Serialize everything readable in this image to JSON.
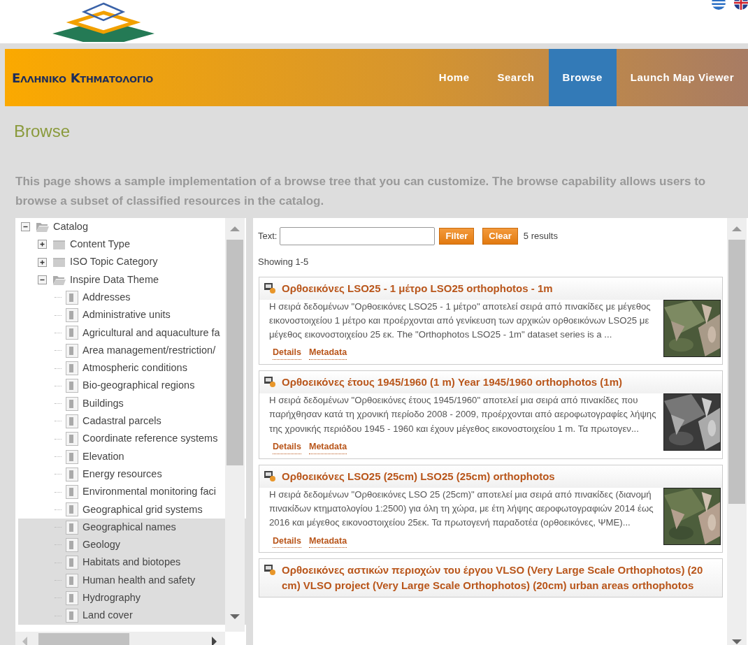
{
  "header": {
    "logo_text": "Ελληνικο Κτηματολογιο",
    "languages": [
      {
        "kind": "greek",
        "selected": false
      },
      {
        "kind": "english",
        "selected": false
      }
    ],
    "nav": [
      {
        "label": "Home",
        "selected": false
      },
      {
        "label": "Search",
        "selected": false
      },
      {
        "label": "Browse",
        "selected": true
      },
      {
        "label": "Launch Map Viewer",
        "selected": false
      }
    ]
  },
  "page": {
    "title": "Browse",
    "intro": "This page shows a sample implementation of a browse tree that you can customize. The browse capability allows users to browse a subset of classified resources in the catalog."
  },
  "tree": [
    {
      "label": "Catalog",
      "expanded": true,
      "children": [
        {
          "label": "Content Type",
          "expanded": false
        },
        {
          "label": "ISO Topic Category",
          "expanded": false
        },
        {
          "label": "Inspire Data Theme",
          "expanded": true,
          "children": [
            {
              "label": "Addresses",
              "shaded": false
            },
            {
              "label": "Administrative units",
              "shaded": false
            },
            {
              "label": "Agricultural and aquaculture fa",
              "shaded": false
            },
            {
              "label": "Area management/restriction/",
              "shaded": false
            },
            {
              "label": "Atmospheric conditions",
              "shaded": false
            },
            {
              "label": "Bio-geographical regions",
              "shaded": false
            },
            {
              "label": "Buildings",
              "shaded": false
            },
            {
              "label": "Cadastral parcels",
              "shaded": false
            },
            {
              "label": "Coordinate reference systems",
              "shaded": false
            },
            {
              "label": "Elevation",
              "shaded": false
            },
            {
              "label": "Energy resources",
              "shaded": false
            },
            {
              "label": "Environmental monitoring faci",
              "shaded": false
            },
            {
              "label": "Geographical grid systems",
              "shaded": false
            },
            {
              "label": "Geographical names",
              "shaded": true
            },
            {
              "label": "Geology",
              "shaded": true
            },
            {
              "label": "Habitats and biotopes",
              "shaded": true
            },
            {
              "label": "Human health and safety",
              "shaded": true
            },
            {
              "label": "Hydrography",
              "shaded": true
            },
            {
              "label": "Land cover",
              "shaded": true
            }
          ]
        }
      ]
    }
  ],
  "filter": {
    "label": "Text:",
    "buttons": [
      "Filter",
      "Clear"
    ],
    "count": "5 results",
    "showing": "Showing 1-5"
  },
  "results": [
    {
      "title": "Ορθοεικόνες LSO25 - 1 μέτρο LSO25 orthophotos - 1m",
      "description": "Η σειρά δεδομένων \"Ορθοεικόνες LSO25 - 1 μέτρο\" αποτελεί σειρά από πινακίδες με μέγεθος εικονοστοιχείου 1 μέτρο και προέρχονται από γενίκευση των αρχικών ορθοεικόνων LSO25 με μέγεθος εικονοστοιχείου 25 εκ. The \"Orthophotos LSO25 - 1m\" dataset series is a ...",
      "links": [
        "Details",
        "Metadata"
      ],
      "thumbnail": {
        "kind": "picture"
      }
    },
    {
      "title": "Ορθοεικόνες έτους 1945/1960 (1 m) Year 1945/1960 orthophotos (1m)",
      "description": "Η σειρά δεδομένων \"Ορθοεικόνες έτους 1945/1960\" αποτελεί μια σειρά από πινακίδες που παρήχθησαν κατά τη χρονική περίοδο 2008 - 2009, προέρχονται από αεροφωτογραφίες λήψης της χρονικής περιόδου 1945 - 1960 και έχουν μέγεθος εικονοστοιχείου 1 m. Τα πρωτογεν...",
      "links": [
        "Details",
        "Metadata"
      ],
      "thumbnail": {
        "kind": "picture"
      }
    },
    {
      "title": "Ορθοεικόνες LSO25 (25cm) LSO25 (25cm) orthophotos",
      "description": "Η σειρά δεδομένων \"Ορθοεικόνες LSO 25 (25cm)\" αποτελεί μια σειρά από πινακίδες (διανομή πινακίδων κτηματολογίου 1:2500) για όλη τη χώρα, με έτη λήψης αεροφωτογραφιών 2014 έως 2016 και μέγεθος εικονοστοιχείου 25εκ. Τα πρωτογενή παραδοτέα (ορθοεικόνες, ΨΜΕ)...",
      "links": [
        "Details",
        "Metadata"
      ],
      "thumbnail": {
        "kind": "picture"
      }
    },
    {
      "title": "Ορθοεικόνες αστικών περιοχών του έργου VLSO (Very Large Scale Orthophotos) (20 cm) VLSO project (Very Large Scale Orthophotos) (20cm) urban areas orthophotos"
    }
  ]
}
